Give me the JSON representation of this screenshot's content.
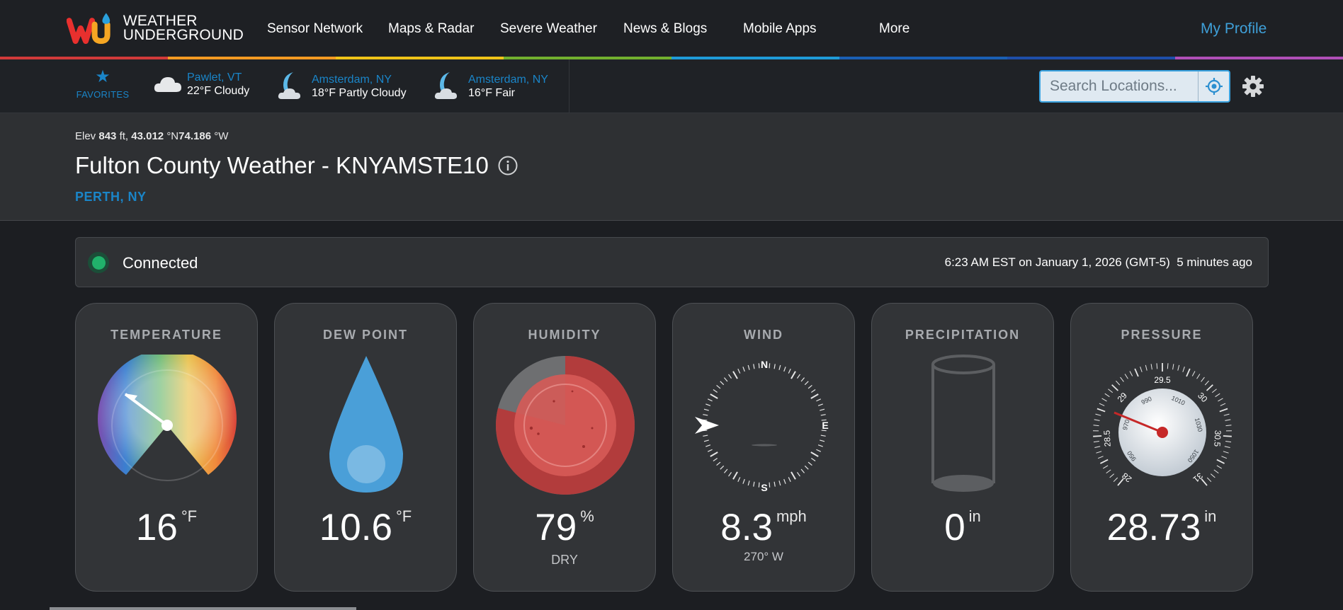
{
  "nav": {
    "logo_line1": "WEATHER",
    "logo_line2": "UNDERGROUND",
    "items": [
      "Sensor Network",
      "Maps & Radar",
      "Severe Weather",
      "News & Blogs",
      "Mobile Apps",
      "More"
    ],
    "profile": "My Profile"
  },
  "rainbow_colors": [
    "#d13a3a",
    "#f39a22",
    "#f0c419",
    "#72b02e",
    "#1f9bd8",
    "#1a5fb4",
    "#1e4ea8",
    "#b04fb7"
  ],
  "favorites": {
    "label": "FAVORITES",
    "items": [
      {
        "city": "Pawlet, VT",
        "condition": "22°F Cloudy",
        "icon": "cloud-icon"
      },
      {
        "city": "Amsterdam, NY",
        "condition": "18°F Partly Cloudy",
        "icon": "moon-cloud-icon"
      },
      {
        "city": "Amsterdam, NY",
        "condition": "16°F Fair",
        "icon": "moon-cloud-icon"
      }
    ]
  },
  "search": {
    "placeholder": "Search Locations..."
  },
  "station": {
    "elev_label": "Elev",
    "elev_value": "843",
    "elev_unit": "ft,",
    "lat": "43.012",
    "lat_unit": "°N",
    "lon": "74.186",
    "lon_unit": "°W",
    "title": "Fulton County Weather - KNYAMSTE10",
    "location": "PERTH, NY"
  },
  "status": {
    "text": "Connected",
    "time": "6:23 AM EST on January 1, 2026 (GMT-5)",
    "ago": "5 minutes ago"
  },
  "cards": {
    "temperature": {
      "title": "TEMPERATURE",
      "value": "16",
      "unit": "°F"
    },
    "dewpoint": {
      "title": "DEW POINT",
      "value": "10.6",
      "unit": "°F"
    },
    "humidity": {
      "title": "HUMIDITY",
      "value": "79",
      "unit": "%",
      "sub": "DRY",
      "level": 0.79
    },
    "wind": {
      "title": "WIND",
      "value": "8.3",
      "unit": "mph",
      "sub": "270° W",
      "dir_N": "N",
      "dir_E": "E",
      "dir_S": "S"
    },
    "precipitation": {
      "title": "PRECIPITATION",
      "value": "0",
      "unit": "in"
    },
    "pressure": {
      "title": "PRESSURE",
      "value": "28.73",
      "unit": "in",
      "ticks": [
        "28",
        "28.5",
        "29",
        "29.5",
        "30",
        "30.5",
        "31"
      ],
      "inner_ticks": [
        "950",
        "970",
        "990",
        "1010",
        "1030",
        "1050"
      ]
    }
  }
}
